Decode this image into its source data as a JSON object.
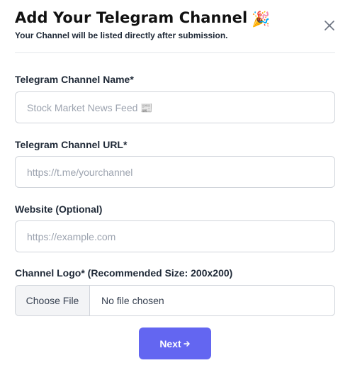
{
  "header": {
    "title": "Add Your Telegram Channel",
    "title_emoji": "🎉",
    "subtitle": "Your Channel will be listed directly after submission.",
    "close_icon": "close-icon"
  },
  "form": {
    "channel_name": {
      "label": "Telegram Channel Name*",
      "placeholder": "Stock Market News Feed 📰",
      "value": ""
    },
    "channel_url": {
      "label": "Telegram Channel URL*",
      "placeholder": "https://t.me/yourchannel",
      "value": ""
    },
    "website": {
      "label": "Website (Optional)",
      "placeholder": "https://example.com",
      "value": ""
    },
    "logo": {
      "label": "Channel Logo* (Recommended Size: 200x200)",
      "choose_label": "Choose File",
      "status": "No file chosen"
    }
  },
  "actions": {
    "next_label": "Next",
    "next_icon": "arrow-right-icon"
  },
  "colors": {
    "accent": "#6366f1",
    "border": "#d1d5db",
    "placeholder": "#9ca3af"
  }
}
